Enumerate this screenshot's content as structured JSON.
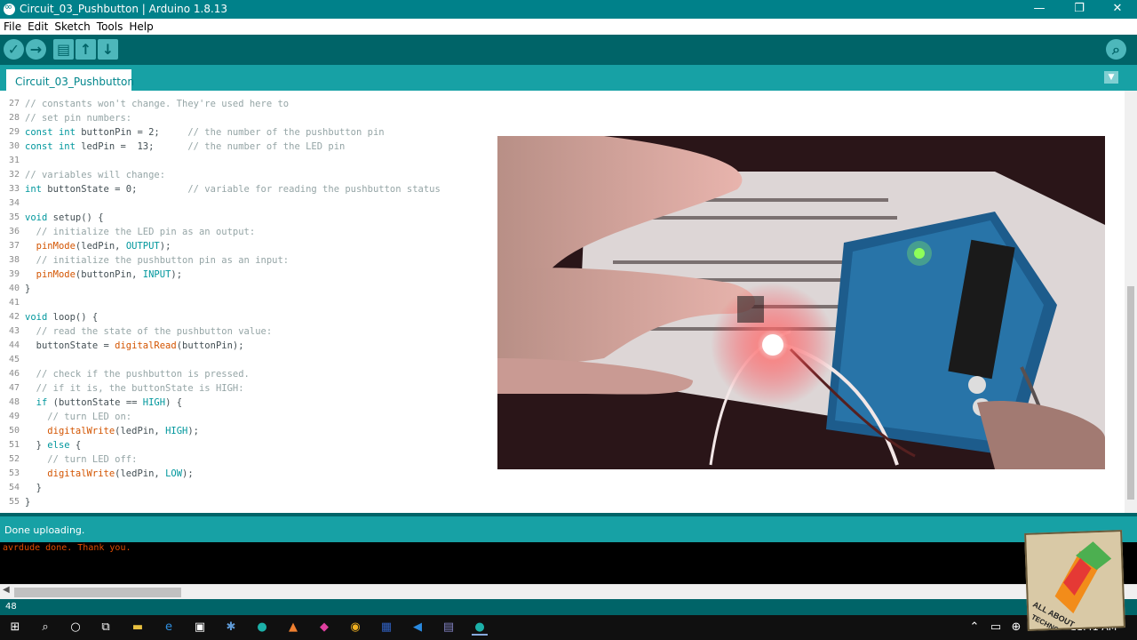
{
  "window": {
    "title": "Circuit_03_Pushbutton | Arduino 1.8.13",
    "minimize": "—",
    "restore": "❐",
    "close": "✕"
  },
  "menu": [
    "File",
    "Edit",
    "Sketch",
    "Tools",
    "Help"
  ],
  "toolbar": {
    "verify": "✓",
    "upload": "→",
    "new": "▤",
    "open": "↑",
    "save": "↓",
    "serial_monitor": "⌕"
  },
  "tab": {
    "label": "Circuit_03_Pushbutton",
    "menu": "▼"
  },
  "code": [
    {
      "n": "27",
      "t": "// constants won't change. They're used here to",
      "k": "c"
    },
    {
      "n": "28",
      "t": "// set pin numbers:",
      "k": "c"
    },
    {
      "n": "29",
      "t": "const int buttonPin = 2;     // the number of the pushbutton pin",
      "k": "m"
    },
    {
      "n": "30",
      "t": "const int ledPin =  13;      // the number of the LED pin",
      "k": "m"
    },
    {
      "n": "31",
      "t": "",
      "k": "p"
    },
    {
      "n": "32",
      "t": "// variables will change:",
      "k": "c"
    },
    {
      "n": "33",
      "t": "int buttonState = 0;         // variable for reading the pushbutton status",
      "k": "m"
    },
    {
      "n": "34",
      "t": "",
      "k": "p"
    },
    {
      "n": "35",
      "t": "void setup() {",
      "k": "m"
    },
    {
      "n": "36",
      "t": "  // initialize the LED pin as an output:",
      "k": "c"
    },
    {
      "n": "37",
      "t": "  pinMode(ledPin, OUTPUT);",
      "k": "m"
    },
    {
      "n": "38",
      "t": "  // initialize the pushbutton pin as an input:",
      "k": "c"
    },
    {
      "n": "39",
      "t": "  pinMode(buttonPin, INPUT);",
      "k": "m"
    },
    {
      "n": "40",
      "t": "}",
      "k": "p"
    },
    {
      "n": "41",
      "t": "",
      "k": "p"
    },
    {
      "n": "42",
      "t": "void loop() {",
      "k": "m"
    },
    {
      "n": "43",
      "t": "  // read the state of the pushbutton value:",
      "k": "c"
    },
    {
      "n": "44",
      "t": "  buttonState = digitalRead(buttonPin);",
      "k": "m"
    },
    {
      "n": "45",
      "t": "",
      "k": "p"
    },
    {
      "n": "46",
      "t": "  // check if the pushbutton is pressed.",
      "k": "c"
    },
    {
      "n": "47",
      "t": "  // if it is, the buttonState is HIGH:",
      "k": "c"
    },
    {
      "n": "48",
      "t": "  if (buttonState == HIGH) {",
      "k": "m"
    },
    {
      "n": "49",
      "t": "    // turn LED on:",
      "k": "c"
    },
    {
      "n": "50",
      "t": "    digitalWrite(ledPin, HIGH);",
      "k": "m"
    },
    {
      "n": "51",
      "t": "  } else {",
      "k": "m"
    },
    {
      "n": "52",
      "t": "    // turn LED off:",
      "k": "c"
    },
    {
      "n": "53",
      "t": "    digitalWrite(ledPin, LOW);",
      "k": "m"
    },
    {
      "n": "54",
      "t": "  }",
      "k": "p"
    },
    {
      "n": "55",
      "t": "}",
      "k": "p"
    }
  ],
  "status": {
    "message": "Done uploading."
  },
  "console": {
    "output": "avrdude done.  Thank you."
  },
  "footer": {
    "line_number": "48"
  },
  "clock": {
    "time": "11:41 AM"
  },
  "logo": {
    "text": "ALL ABOUT TECHNOLOGY"
  },
  "colors": {
    "teal": "#00818a",
    "dark_teal": "#006468",
    "console_text": "#e34c00"
  }
}
